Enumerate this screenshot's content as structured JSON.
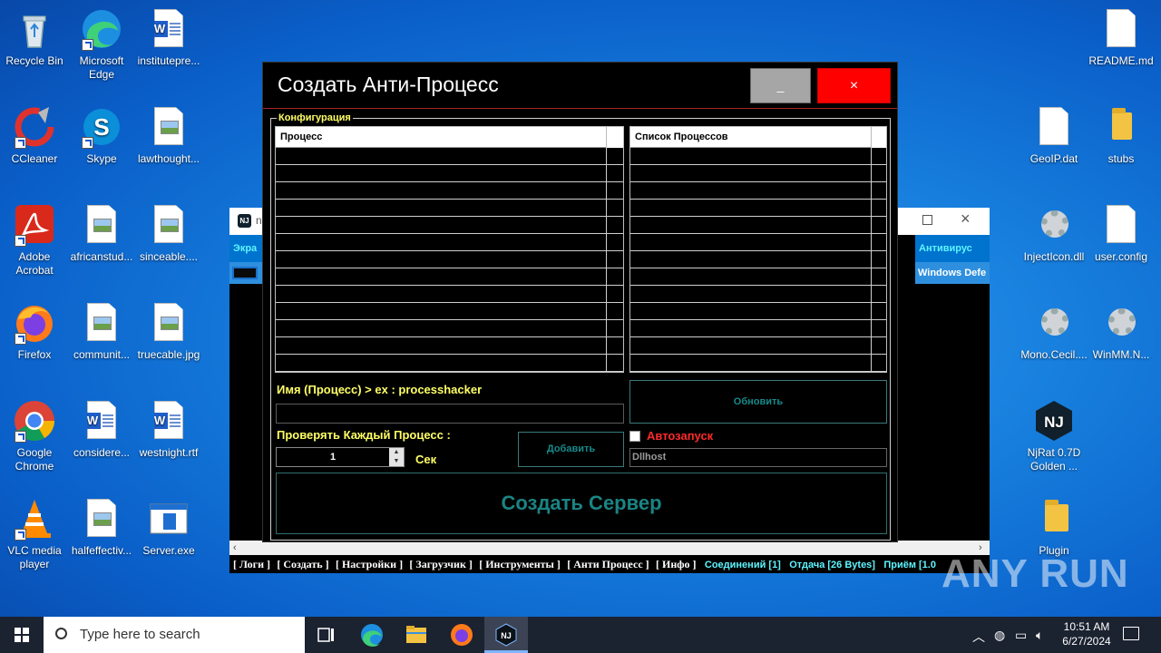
{
  "desktop": {
    "left_icons": [
      {
        "label": "Recycle Bin"
      },
      {
        "label": "Microsoft Edge"
      },
      {
        "label": "institutepre..."
      },
      {
        "label": "CCleaner"
      },
      {
        "label": "Skype"
      },
      {
        "label": "lawthought..."
      },
      {
        "label": "Adobe Acrobat"
      },
      {
        "label": "africanstud..."
      },
      {
        "label": "sinceable...."
      },
      {
        "label": "Firefox"
      },
      {
        "label": "communit..."
      },
      {
        "label": "truecable.jpg"
      },
      {
        "label": "Google Chrome"
      },
      {
        "label": "considere..."
      },
      {
        "label": "westnight.rtf"
      },
      {
        "label": "VLC media player"
      },
      {
        "label": "halfeffectiv..."
      },
      {
        "label": "Server.exe"
      }
    ],
    "right_icons": [
      {
        "label": "README.md"
      },
      {
        "label": "GeoIP.dat"
      },
      {
        "label": "stubs"
      },
      {
        "label": "InjectIcon.dll"
      },
      {
        "label": "user.config"
      },
      {
        "label": "Mono.Cecil...."
      },
      {
        "label": "WinMM.N..."
      },
      {
        "label": "NjRat 0.7D Golden ..."
      },
      {
        "label": "Plugin"
      }
    ]
  },
  "bg_window": {
    "title_fragment": "n",
    "col_left": "Экра",
    "col_right": "Антивирус",
    "row_right": "Windows Defe"
  },
  "statusbar": {
    "menu": [
      "[ Логи ]",
      "[ Создать ]",
      "[ Настройки ]",
      "[ Загрузчик ]",
      "[ Инструменты ]",
      "[ Анти Процесс ]",
      "[ Инфо ]"
    ],
    "connections": "Соединений [1]",
    "upload": "Отдача [26 Bytes]",
    "download": "Приём [1.0"
  },
  "dialog": {
    "title": "Создать Анти-Процесс",
    "minimize_label": "_",
    "close_label": "×",
    "group_label": "Конфигурация",
    "list_left_header": "Процесс",
    "list_right_header": "Список Процессов",
    "name_label": "Имя (Процесс) > ex : processhacker",
    "name_value": "",
    "refresh_label": "Обновить",
    "check_label": "Проверять Каждый Процесс :",
    "interval_value": "1",
    "sec_label": "Сек",
    "add_label": "Добавить",
    "autostart_label": "Автозапуск",
    "autostart_checked": false,
    "autostart_value": "Dllhost",
    "create_label": "Создать Сервер"
  },
  "taskbar": {
    "search_placeholder": "Type here to search",
    "time": "10:51 AM",
    "date": "6/27/2024"
  },
  "watermark": "ANY RUN",
  "colors": {
    "accent_red": "#ff0000",
    "label_yellow": "#ffff66",
    "teal": "#178a8a",
    "cyan": "#5ef5ff"
  }
}
